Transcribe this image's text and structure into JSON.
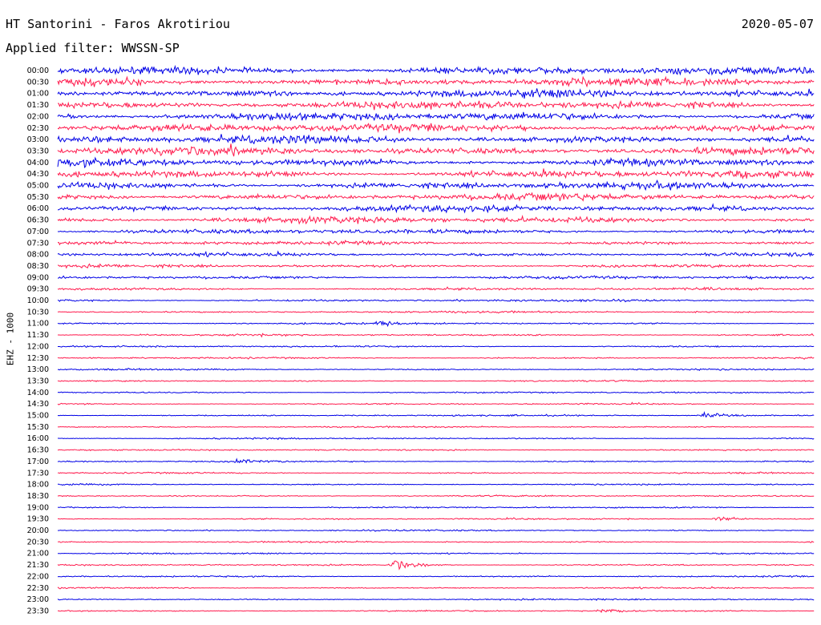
{
  "header": {
    "title": "HT Santorini - Faros Akrotiriou",
    "date": "2020-05-07",
    "filter_label": "Applied filter: WWSSN-SP"
  },
  "channel_label": "EHZ - 1000",
  "colors": {
    "even_trace": "#0000e6",
    "odd_trace": "#ff1a4d"
  },
  "chart_data": {
    "type": "line",
    "chart_kind": "helicorder",
    "row_labels": [
      "00:00",
      "00:30",
      "01:00",
      "01:30",
      "02:00",
      "02:30",
      "03:00",
      "03:30",
      "04:00",
      "04:30",
      "05:00",
      "05:30",
      "06:00",
      "06:30",
      "07:00",
      "07:30",
      "08:00",
      "08:30",
      "09:00",
      "09:30",
      "10:00",
      "10:30",
      "11:00",
      "11:30",
      "12:00",
      "12:30",
      "13:00",
      "13:30",
      "14:00",
      "14:30",
      "15:00",
      "15:30",
      "16:00",
      "16:30",
      "17:00",
      "17:30",
      "18:00",
      "18:30",
      "19:00",
      "19:30",
      "20:00",
      "20:30",
      "21:00",
      "21:30",
      "22:00",
      "22:30",
      "23:00",
      "23:30"
    ],
    "noise_amplitude": [
      6.5,
      6.5,
      6.5,
      6.5,
      6.5,
      6.5,
      6.5,
      6.5,
      6,
      6,
      5.5,
      5.5,
      5,
      5,
      3.5,
      3,
      3,
      2.5,
      2.5,
      2,
      1.8,
      1.6,
      1.5,
      1.5,
      1.3,
      1.3,
      1.3,
      1.2,
      1.2,
      1.2,
      1.2,
      1.2,
      1.2,
      1.2,
      1.2,
      1.2,
      1.2,
      1.2,
      1.2,
      1.2,
      1.2,
      1.2,
      1.2,
      1.2,
      1.2,
      1.2,
      1.2,
      1.2
    ],
    "events": [
      {
        "row": "11:00",
        "minute": 12.6,
        "amplitude": 7
      },
      {
        "row": "15:00",
        "minute": 25.6,
        "amplitude": 7
      },
      {
        "row": "17:00",
        "minute": 7.1,
        "amplitude": 6
      },
      {
        "row": "19:30",
        "minute": 26.1,
        "amplitude": 6
      },
      {
        "row": "21:30",
        "minute": 13.3,
        "amplitude": 10
      },
      {
        "row": "23:30",
        "minute": 21.5,
        "amplitude": 5
      }
    ],
    "legend": "none"
  }
}
